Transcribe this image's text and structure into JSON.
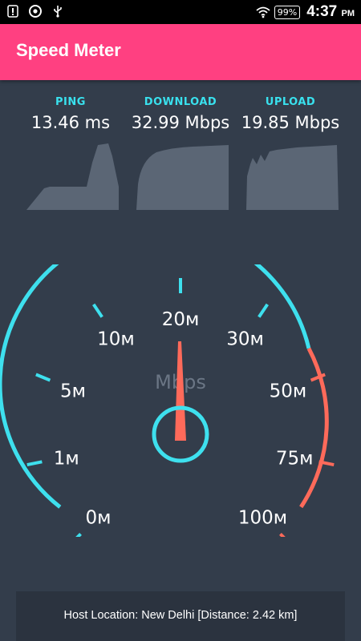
{
  "status_bar": {
    "icons": [
      "notification-icon",
      "chrome-icon",
      "usb-icon",
      "wifi-icon"
    ],
    "battery": "99%",
    "time": "4:37",
    "ampm": "PM"
  },
  "app_bar": {
    "title": "Speed Meter"
  },
  "stats": {
    "ping": {
      "label": "PING",
      "value": "13.46 ms"
    },
    "download": {
      "label": "DOWNLOAD",
      "value": "32.99 Mbps"
    },
    "upload": {
      "label": "UPLOAD",
      "value": "19.85 Mbps"
    }
  },
  "gauge": {
    "unit": "Mbps",
    "ticks": [
      "0м",
      "1м",
      "5м",
      "10м",
      "20м",
      "30м",
      "50м",
      "75м",
      "100м"
    ],
    "needle_value": "20м",
    "colors": {
      "normal": "#3ee0ee",
      "high": "#ff6a5a",
      "needle": "#ff6a5a"
    }
  },
  "host": {
    "text": "Host Location: New Delhi [Distance: 2.42 km]"
  }
}
